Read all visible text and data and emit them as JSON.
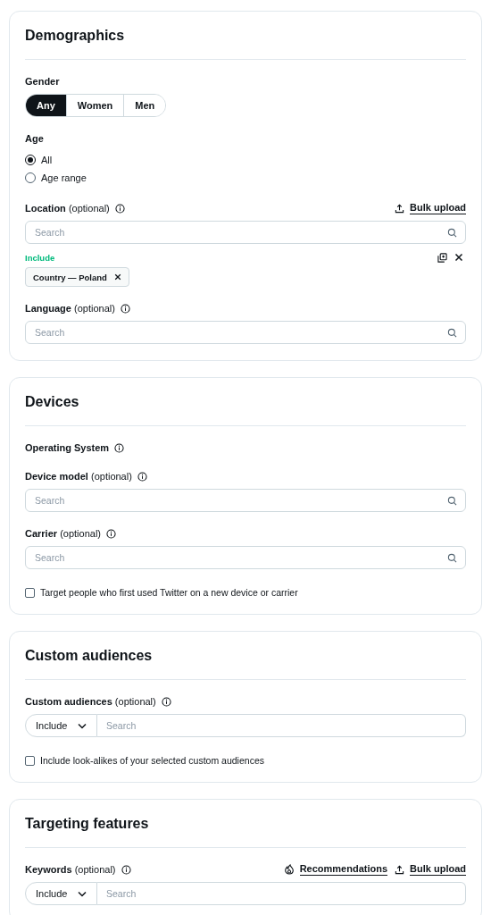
{
  "sections": [
    {
      "title": "Demographics",
      "fields": [
        {
          "kind": "segmented",
          "label": "Gender",
          "options": [
            {
              "label": "Any",
              "selected": true
            },
            {
              "label": "Women",
              "selected": false
            },
            {
              "label": "Men",
              "selected": false
            }
          ]
        },
        {
          "kind": "radio",
          "label": "Age",
          "options": [
            {
              "label": "All",
              "selected": true
            },
            {
              "label": "Age range",
              "selected": false
            }
          ]
        },
        {
          "kind": "search",
          "label": "Location",
          "hint": "(optional)",
          "info": true,
          "actions": [
            {
              "kind": "upload",
              "label": "Bulk upload"
            }
          ],
          "placeholder": "Search",
          "include": {
            "label": "Include",
            "chips": [
              "Country — Poland"
            ]
          }
        },
        {
          "kind": "search",
          "label": "Language",
          "hint": "(optional)",
          "info": true,
          "placeholder": "Search"
        }
      ]
    },
    {
      "title": "Devices",
      "fields": [
        {
          "kind": "label",
          "label": "Operating System",
          "info": true
        },
        {
          "kind": "search",
          "label": "Device model",
          "hint": "(optional)",
          "info": true,
          "placeholder": "Search"
        },
        {
          "kind": "search",
          "label": "Carrier",
          "hint": "(optional)",
          "info": true,
          "placeholder": "Search"
        },
        {
          "kind": "checkbox",
          "label": "Target people who first used Twitter on a new device or carrier",
          "checked": false
        }
      ]
    },
    {
      "title": "Custom audiences",
      "fields": [
        {
          "kind": "combo",
          "label": "Custom audiences",
          "hint": "(optional)",
          "info": true,
          "mode": "Include",
          "placeholder": "Search"
        },
        {
          "kind": "checkbox",
          "label": "Include look-alikes of your selected custom audiences",
          "checked": false
        }
      ]
    },
    {
      "title": "Targeting features",
      "fields": [
        {
          "kind": "combo",
          "label": "Keywords",
          "hint": "(optional)",
          "info": true,
          "actions": [
            {
              "kind": "recommend",
              "label": "Recommendations"
            },
            {
              "kind": "upload",
              "label": "Bulk upload"
            }
          ],
          "mode": "Include",
          "placeholder": "Search"
        }
      ]
    }
  ]
}
